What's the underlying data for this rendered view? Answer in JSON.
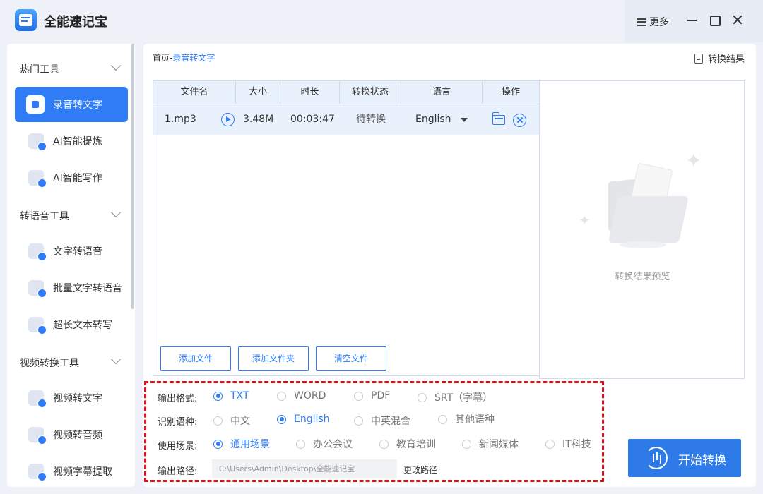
{
  "app": {
    "title": "全能速记宝",
    "more_label": "更多"
  },
  "sidebar": {
    "groups": [
      {
        "label": "热门工具",
        "items": [
          {
            "label": "录音转文字"
          },
          {
            "label": "AI智能提炼"
          },
          {
            "label": "AI智能写作"
          }
        ]
      },
      {
        "label": "转语音工具",
        "items": [
          {
            "label": "文字转语音"
          },
          {
            "label": "批量文字转语音"
          },
          {
            "label": "超长文本转写"
          }
        ]
      },
      {
        "label": "视频转换工具",
        "items": [
          {
            "label": "视频转文字"
          },
          {
            "label": "视频转音频"
          },
          {
            "label": "视频字幕提取"
          }
        ]
      }
    ]
  },
  "main": {
    "breadcrumb": {
      "home": "首页",
      "sep": "-",
      "current": "录音转文字"
    },
    "result_link": "转换结果",
    "table": {
      "columns": [
        "文件名",
        "大小",
        "时长",
        "转换状态",
        "语言",
        "操作"
      ],
      "rows": [
        {
          "name": "1.mp3",
          "size": "3.48M",
          "duration": "00:03:47",
          "status": "待转换",
          "language": "English"
        }
      ]
    },
    "buttons": {
      "add_file": "添加文件",
      "add_folder": "添加文件夹",
      "clear": "清空文件"
    },
    "preview": {
      "text": "转换结果预览"
    }
  },
  "options": {
    "format": {
      "label": "输出格式:",
      "options": [
        "TXT",
        "WORD",
        "PDF",
        "SRT（字幕）"
      ],
      "selected": "TXT"
    },
    "language": {
      "label": "识别语种:",
      "options": [
        "中文",
        "English",
        "中英混合",
        "其他语种"
      ],
      "selected": "English"
    },
    "scene": {
      "label": "使用场景:",
      "options": [
        "通用场景",
        "办公会议",
        "教育培训",
        "新闻媒体",
        "IT科技"
      ],
      "selected": "通用场景"
    },
    "output": {
      "label": "输出路径:",
      "path": "C:\\Users\\Admin\\Desktop\\全能速记宝",
      "change_label": "更改路径"
    }
  },
  "start_button": "开始转换",
  "colors": {
    "accent": "#2f7cf6",
    "highlight_border": "#d9141a"
  }
}
